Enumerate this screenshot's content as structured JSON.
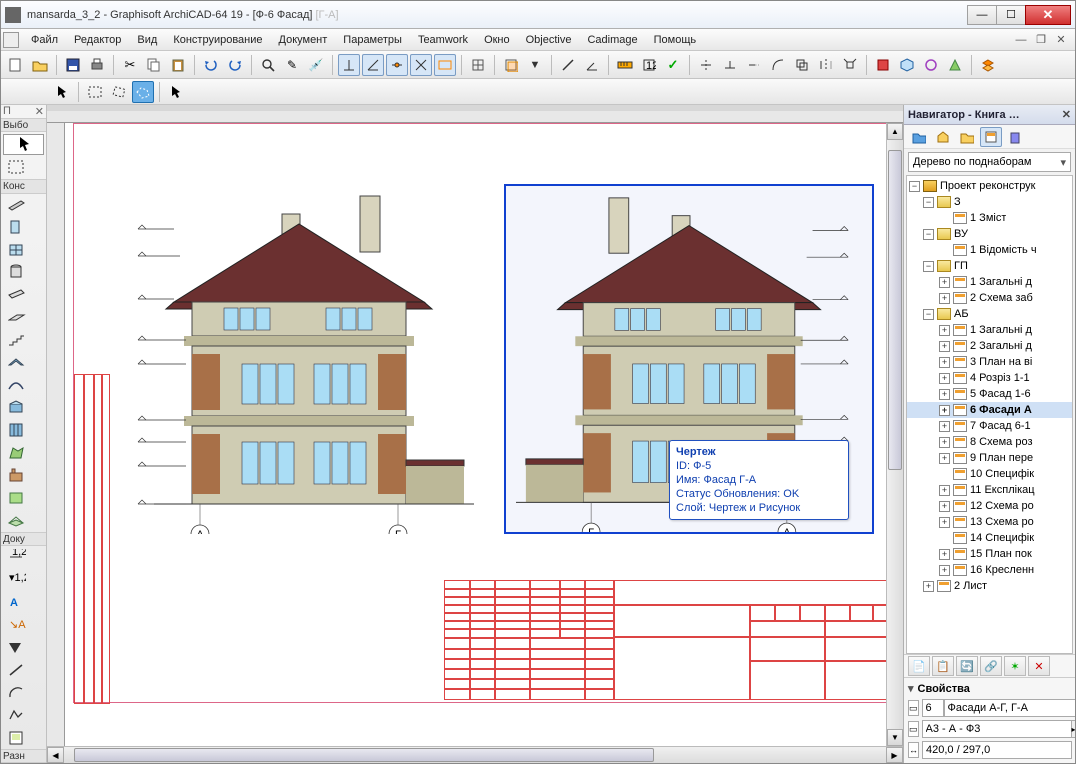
{
  "title": {
    "main": "mansarda_3_2 - Graphisoft ArchiCAD-64 19 - [Ф-6 Фасад]",
    "faded": " [Г-А]"
  },
  "menu": [
    "Файл",
    "Редактор",
    "Вид",
    "Конструирование",
    "Документ",
    "Параметры",
    "Teamwork",
    "Окно",
    "Objective",
    "Cadimage",
    "Помощь"
  ],
  "left_sections": {
    "s1": "П",
    "s2": "Выбо",
    "s3": "Конс",
    "s4": "Доку",
    "s5": "Разн"
  },
  "tooltip": {
    "title": "Чертеж",
    "l1": "ID: Ф-5",
    "l2": "Имя: Фасад Г-А",
    "l3": "Статус Обновления: OK",
    "l4": "Слой: Чертеж и Рисунок"
  },
  "navigator": {
    "title": "Навигатор - Книга …",
    "combo": "Дерево по поднаборам",
    "root": "Проект реконструк",
    "groups": {
      "g1": "З",
      "g1_1": "1 Зміст",
      "g2": "ВУ",
      "g2_1": "1 Відомість ч",
      "g3": "ГП",
      "g3_1": "1 Загальні д",
      "g3_2": "2 Схема заб",
      "g4": "АБ",
      "g4_1": "1 Загальні д",
      "g4_2": "2 Загальні д",
      "g4_3": "3 План на ві",
      "g4_4": "4 Розріз 1-1",
      "g4_5": "5 Фасад 1-6",
      "g4_6": "6 Фасади А",
      "g4_7": "7 Фасад 6-1",
      "g4_8": "8 Схема роз",
      "g4_9": "9 План пере",
      "g4_10": "10  Специфік",
      "g4_11": "11 Експлікац",
      "g4_12": "12 Схема ро",
      "g4_13": "13 Схема ро",
      "g4_14": "14 Специфік",
      "g4_15": "15 План пок",
      "g4_16": "16 Кресленн",
      "g5": "2 Лист"
    },
    "properties": "Свойства",
    "prop_num": "6",
    "prop_name": "Фасади А-Г, Г-А",
    "prop_size": "A3 - А - Ф3",
    "prop_dim1": "420,0 / 297,0",
    "prop_dim_icon": "↔"
  },
  "axes": {
    "a": "А",
    "g": "Г"
  }
}
